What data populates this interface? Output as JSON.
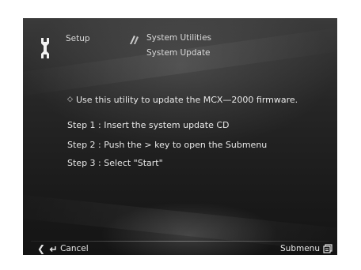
{
  "header": {
    "section_label": "Setup",
    "category_label": "System Utilities",
    "page_title": "System Update"
  },
  "content": {
    "intro": "Use this utility to update the MCX—2000 firmware.",
    "bullet": "◇",
    "steps": [
      "Step 1 : Insert the system update CD",
      "Step 2 : Push the > key to open the Submenu",
      "Step 3 : Select \"Start\""
    ]
  },
  "footer": {
    "cancel_label": "Cancel",
    "submenu_label": "Submenu"
  },
  "icons": {
    "setup": "wrench-icon",
    "utilities": "tools-icon",
    "back": "chevron-left-icon",
    "return": "return-arrow-icon",
    "submenu": "submenu-icon",
    "forward": "chevron-right-icon"
  },
  "colors": {
    "background": "#1c1c1c",
    "text": "#e8e8e8"
  }
}
